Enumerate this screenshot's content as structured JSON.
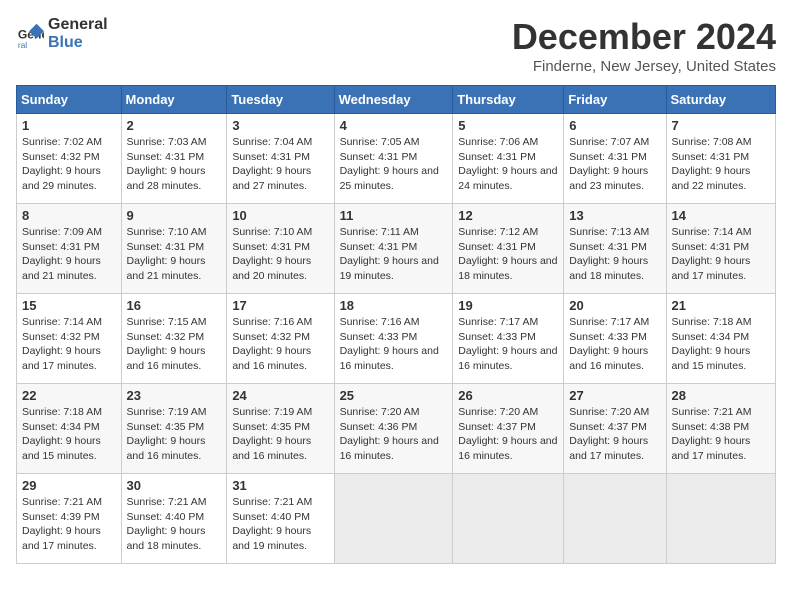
{
  "logo": {
    "line1": "General",
    "line2": "Blue"
  },
  "title": "December 2024",
  "subtitle": "Finderne, New Jersey, United States",
  "days_header": [
    "Sunday",
    "Monday",
    "Tuesday",
    "Wednesday",
    "Thursday",
    "Friday",
    "Saturday"
  ],
  "weeks": [
    [
      {
        "day": "1",
        "sunrise": "Sunrise: 7:02 AM",
        "sunset": "Sunset: 4:32 PM",
        "daylight": "Daylight: 9 hours and 29 minutes."
      },
      {
        "day": "2",
        "sunrise": "Sunrise: 7:03 AM",
        "sunset": "Sunset: 4:31 PM",
        "daylight": "Daylight: 9 hours and 28 minutes."
      },
      {
        "day": "3",
        "sunrise": "Sunrise: 7:04 AM",
        "sunset": "Sunset: 4:31 PM",
        "daylight": "Daylight: 9 hours and 27 minutes."
      },
      {
        "day": "4",
        "sunrise": "Sunrise: 7:05 AM",
        "sunset": "Sunset: 4:31 PM",
        "daylight": "Daylight: 9 hours and 25 minutes."
      },
      {
        "day": "5",
        "sunrise": "Sunrise: 7:06 AM",
        "sunset": "Sunset: 4:31 PM",
        "daylight": "Daylight: 9 hours and 24 minutes."
      },
      {
        "day": "6",
        "sunrise": "Sunrise: 7:07 AM",
        "sunset": "Sunset: 4:31 PM",
        "daylight": "Daylight: 9 hours and 23 minutes."
      },
      {
        "day": "7",
        "sunrise": "Sunrise: 7:08 AM",
        "sunset": "Sunset: 4:31 PM",
        "daylight": "Daylight: 9 hours and 22 minutes."
      }
    ],
    [
      {
        "day": "8",
        "sunrise": "Sunrise: 7:09 AM",
        "sunset": "Sunset: 4:31 PM",
        "daylight": "Daylight: 9 hours and 21 minutes."
      },
      {
        "day": "9",
        "sunrise": "Sunrise: 7:10 AM",
        "sunset": "Sunset: 4:31 PM",
        "daylight": "Daylight: 9 hours and 21 minutes."
      },
      {
        "day": "10",
        "sunrise": "Sunrise: 7:10 AM",
        "sunset": "Sunset: 4:31 PM",
        "daylight": "Daylight: 9 hours and 20 minutes."
      },
      {
        "day": "11",
        "sunrise": "Sunrise: 7:11 AM",
        "sunset": "Sunset: 4:31 PM",
        "daylight": "Daylight: 9 hours and 19 minutes."
      },
      {
        "day": "12",
        "sunrise": "Sunrise: 7:12 AM",
        "sunset": "Sunset: 4:31 PM",
        "daylight": "Daylight: 9 hours and 18 minutes."
      },
      {
        "day": "13",
        "sunrise": "Sunrise: 7:13 AM",
        "sunset": "Sunset: 4:31 PM",
        "daylight": "Daylight: 9 hours and 18 minutes."
      },
      {
        "day": "14",
        "sunrise": "Sunrise: 7:14 AM",
        "sunset": "Sunset: 4:31 PM",
        "daylight": "Daylight: 9 hours and 17 minutes."
      }
    ],
    [
      {
        "day": "15",
        "sunrise": "Sunrise: 7:14 AM",
        "sunset": "Sunset: 4:32 PM",
        "daylight": "Daylight: 9 hours and 17 minutes."
      },
      {
        "day": "16",
        "sunrise": "Sunrise: 7:15 AM",
        "sunset": "Sunset: 4:32 PM",
        "daylight": "Daylight: 9 hours and 16 minutes."
      },
      {
        "day": "17",
        "sunrise": "Sunrise: 7:16 AM",
        "sunset": "Sunset: 4:32 PM",
        "daylight": "Daylight: 9 hours and 16 minutes."
      },
      {
        "day": "18",
        "sunrise": "Sunrise: 7:16 AM",
        "sunset": "Sunset: 4:33 PM",
        "daylight": "Daylight: 9 hours and 16 minutes."
      },
      {
        "day": "19",
        "sunrise": "Sunrise: 7:17 AM",
        "sunset": "Sunset: 4:33 PM",
        "daylight": "Daylight: 9 hours and 16 minutes."
      },
      {
        "day": "20",
        "sunrise": "Sunrise: 7:17 AM",
        "sunset": "Sunset: 4:33 PM",
        "daylight": "Daylight: 9 hours and 16 minutes."
      },
      {
        "day": "21",
        "sunrise": "Sunrise: 7:18 AM",
        "sunset": "Sunset: 4:34 PM",
        "daylight": "Daylight: 9 hours and 15 minutes."
      }
    ],
    [
      {
        "day": "22",
        "sunrise": "Sunrise: 7:18 AM",
        "sunset": "Sunset: 4:34 PM",
        "daylight": "Daylight: 9 hours and 15 minutes."
      },
      {
        "day": "23",
        "sunrise": "Sunrise: 7:19 AM",
        "sunset": "Sunset: 4:35 PM",
        "daylight": "Daylight: 9 hours and 16 minutes."
      },
      {
        "day": "24",
        "sunrise": "Sunrise: 7:19 AM",
        "sunset": "Sunset: 4:35 PM",
        "daylight": "Daylight: 9 hours and 16 minutes."
      },
      {
        "day": "25",
        "sunrise": "Sunrise: 7:20 AM",
        "sunset": "Sunset: 4:36 PM",
        "daylight": "Daylight: 9 hours and 16 minutes."
      },
      {
        "day": "26",
        "sunrise": "Sunrise: 7:20 AM",
        "sunset": "Sunset: 4:37 PM",
        "daylight": "Daylight: 9 hours and 16 minutes."
      },
      {
        "day": "27",
        "sunrise": "Sunrise: 7:20 AM",
        "sunset": "Sunset: 4:37 PM",
        "daylight": "Daylight: 9 hours and 17 minutes."
      },
      {
        "day": "28",
        "sunrise": "Sunrise: 7:21 AM",
        "sunset": "Sunset: 4:38 PM",
        "daylight": "Daylight: 9 hours and 17 minutes."
      }
    ],
    [
      {
        "day": "29",
        "sunrise": "Sunrise: 7:21 AM",
        "sunset": "Sunset: 4:39 PM",
        "daylight": "Daylight: 9 hours and 17 minutes."
      },
      {
        "day": "30",
        "sunrise": "Sunrise: 7:21 AM",
        "sunset": "Sunset: 4:40 PM",
        "daylight": "Daylight: 9 hours and 18 minutes."
      },
      {
        "day": "31",
        "sunrise": "Sunrise: 7:21 AM",
        "sunset": "Sunset: 4:40 PM",
        "daylight": "Daylight: 9 hours and 19 minutes."
      },
      {
        "day": "",
        "sunrise": "",
        "sunset": "",
        "daylight": ""
      },
      {
        "day": "",
        "sunrise": "",
        "sunset": "",
        "daylight": ""
      },
      {
        "day": "",
        "sunrise": "",
        "sunset": "",
        "daylight": ""
      },
      {
        "day": "",
        "sunrise": "",
        "sunset": "",
        "daylight": ""
      }
    ]
  ]
}
